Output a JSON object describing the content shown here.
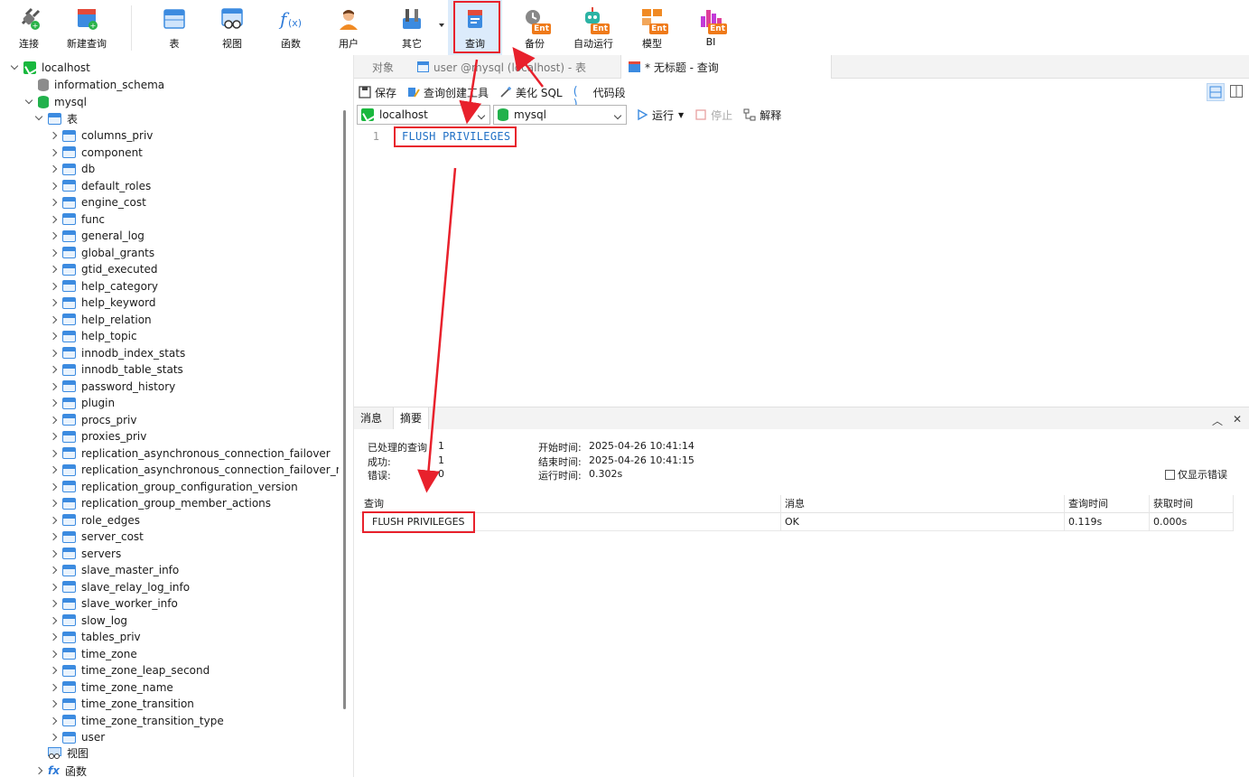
{
  "toolbar": {
    "connect": "连接",
    "new_query": "新建查询",
    "table": "表",
    "view": "视图",
    "function": "函数",
    "user": "用户",
    "other": "其它",
    "query": "查询",
    "backup": "备份",
    "automation": "自动运行",
    "model": "模型",
    "bi": "BI",
    "ent_badge": "Ent"
  },
  "tree": {
    "host": "localhost",
    "db_info_schema": "information_schema",
    "db_mysql": "mysql",
    "tables_group": "表",
    "tables": [
      "columns_priv",
      "component",
      "db",
      "default_roles",
      "engine_cost",
      "func",
      "general_log",
      "global_grants",
      "gtid_executed",
      "help_category",
      "help_keyword",
      "help_relation",
      "help_topic",
      "innodb_index_stats",
      "innodb_table_stats",
      "password_history",
      "plugin",
      "procs_priv",
      "proxies_priv",
      "replication_asynchronous_connection_failover",
      "replication_asynchronous_connection_failover_manage",
      "replication_group_configuration_version",
      "replication_group_member_actions",
      "role_edges",
      "server_cost",
      "servers",
      "slave_master_info",
      "slave_relay_log_info",
      "slave_worker_info",
      "slow_log",
      "tables_priv",
      "time_zone",
      "time_zone_leap_second",
      "time_zone_name",
      "time_zone_transition",
      "time_zone_transition_type",
      "user"
    ],
    "views_group": "视图",
    "functions_group": "函数"
  },
  "tabs": {
    "objects": "对象",
    "user_table": "user @mysql (localhost) - 表",
    "query_tab": "* 无标题 - 查询"
  },
  "editor_toolbar": {
    "save": "保存",
    "query_builder": "查询创建工具",
    "beautify": "美化 SQL",
    "snippet": "代码段",
    "run": "运行",
    "stop": "停止",
    "explain": "解释"
  },
  "selectors": {
    "connection": "localhost",
    "database": "mysql"
  },
  "editor": {
    "line_number": "1",
    "sql": "FLUSH PRIVILEGES"
  },
  "result": {
    "tab_message": "消息",
    "tab_summary": "摘要",
    "processed_label": "已处理的查询",
    "processed_value": "1",
    "success_label": "成功:",
    "success_value": "1",
    "error_label": "错误:",
    "error_value": "0",
    "start_label": "开始时间:",
    "start_value": "2025-04-26 10:41:14",
    "end_label": "结束时间:",
    "end_value": "2025-04-26 10:41:15",
    "elapsed_label": "运行时间:",
    "elapsed_value": "0.302s",
    "only_errors": "仅显示错误",
    "columns": [
      "查询",
      "消息",
      "查询时间",
      "获取时间"
    ],
    "rows": [
      [
        "FLUSH PRIVILEGES",
        "OK",
        "0.119s",
        "0.000s"
      ]
    ]
  },
  "colors": {
    "annotation_red": "#e8212c",
    "accent_blue": "#3c8be0",
    "code_blue": "#1f6fc5"
  }
}
